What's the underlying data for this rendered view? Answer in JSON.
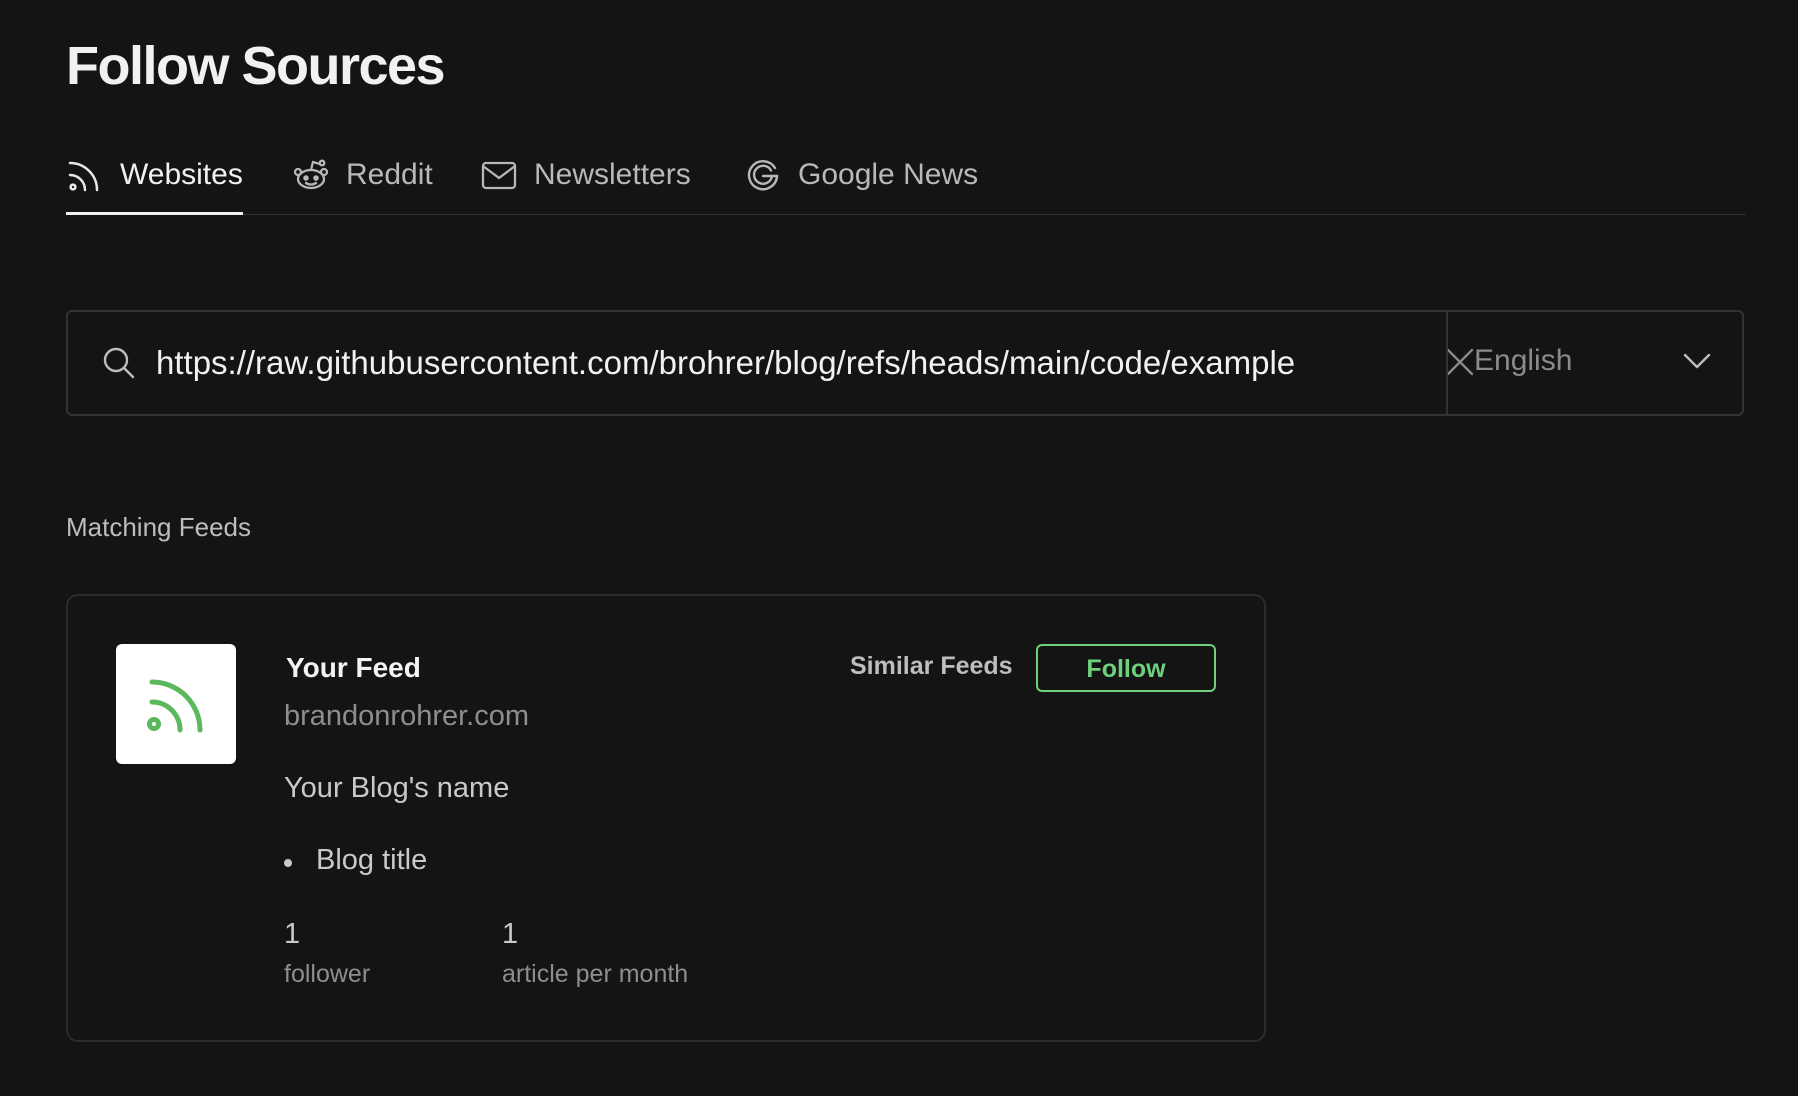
{
  "page": {
    "title": "Follow Sources"
  },
  "tabs": [
    {
      "label": "Websites",
      "icon": "rss-icon",
      "active": true
    },
    {
      "label": "Reddit",
      "icon": "reddit-icon",
      "active": false
    },
    {
      "label": "Newsletters",
      "icon": "mail-icon",
      "active": false
    },
    {
      "label": "Google News",
      "icon": "google-icon",
      "active": false
    }
  ],
  "search": {
    "value": "https://raw.githubusercontent.com/brohrer/blog/refs/heads/main/code/example",
    "placeholder": "",
    "icon": "search-icon",
    "clear_icon": "close-icon"
  },
  "language": {
    "selected": "English",
    "icon": "chevron-down-icon"
  },
  "results": {
    "section_label": "Matching Feeds",
    "feeds": [
      {
        "name": "Your Feed",
        "domain": "brandonrohrer.com",
        "description": "Your Blog's name",
        "items": [
          "Blog title"
        ],
        "followers_value": "1",
        "followers_label": "follower",
        "articles_value": "1",
        "articles_label": "article per month",
        "similar_label": "Similar Feeds",
        "follow_label": "Follow",
        "logo_icon": "rss-icon"
      }
    ]
  },
  "colors": {
    "background": "#141414",
    "accent": "#6fd07c",
    "border": "#2c2c2c"
  }
}
